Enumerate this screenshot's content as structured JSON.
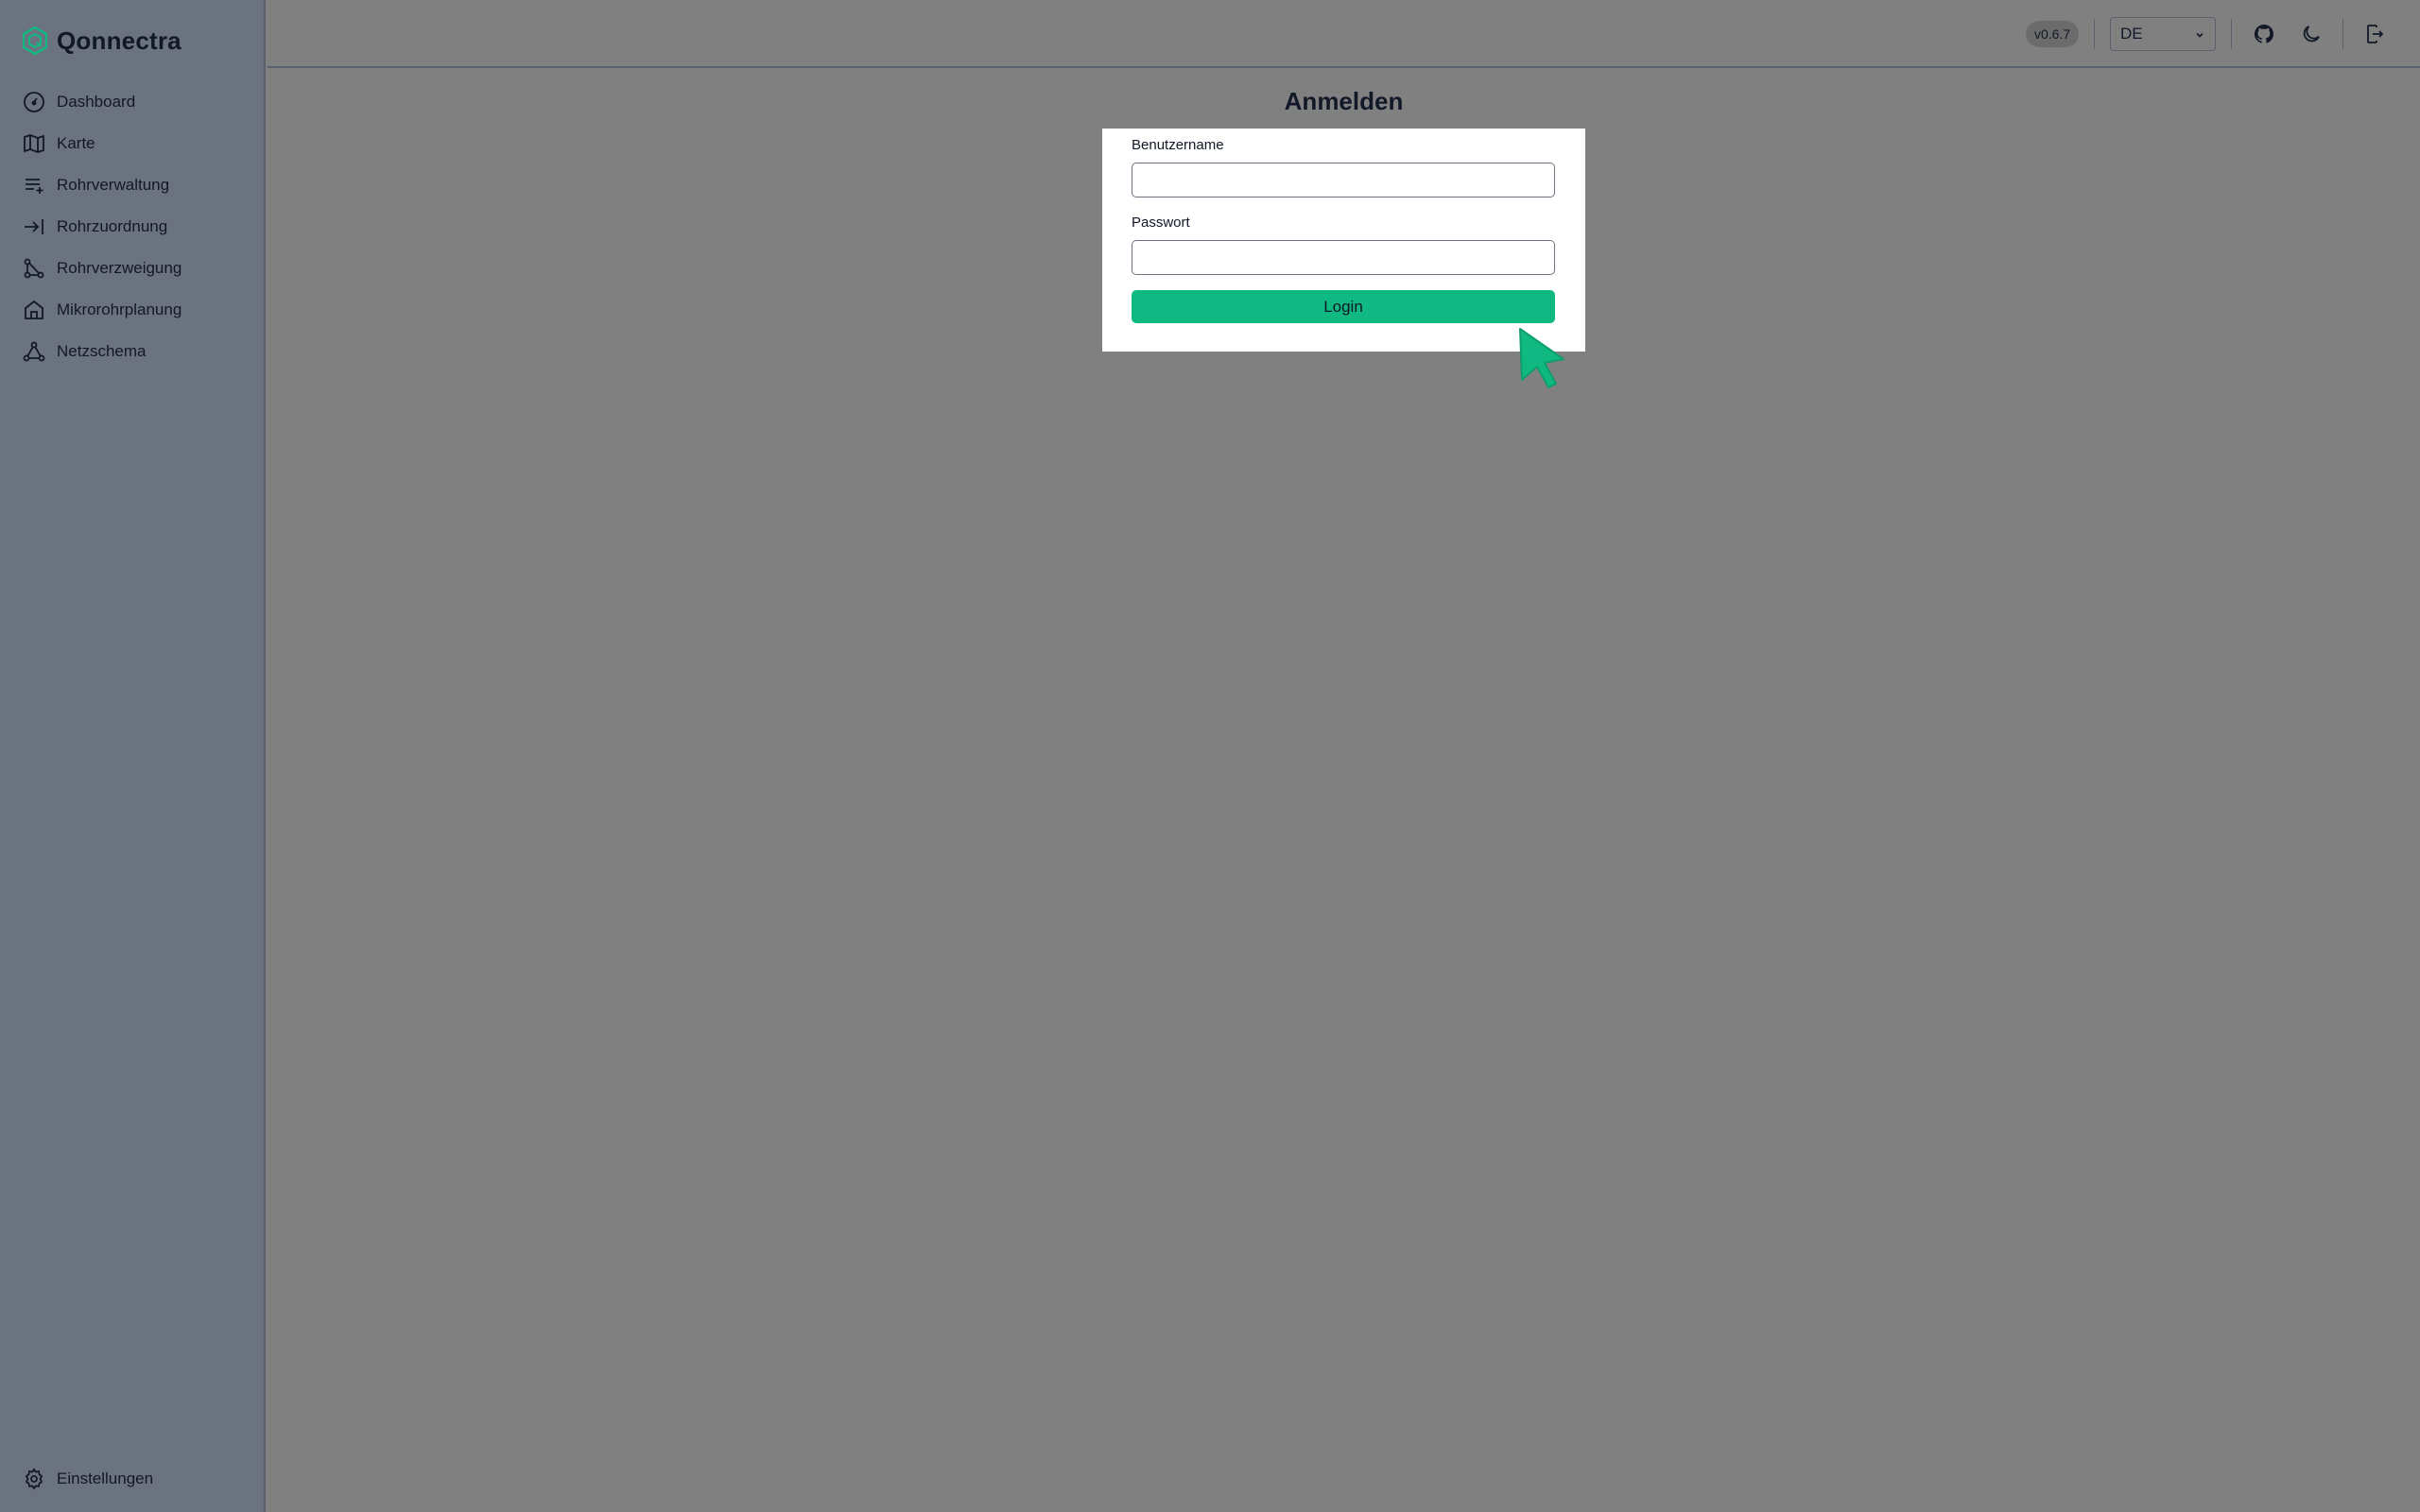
{
  "app": {
    "name": "Qonnectra",
    "brand_color": "#10b981"
  },
  "sidebar": {
    "items": [
      {
        "label": "Dashboard",
        "icon": "dashboard-gauge-icon"
      },
      {
        "label": "Karte",
        "icon": "map-icon"
      },
      {
        "label": "Rohrverwaltung",
        "icon": "list-plus-icon"
      },
      {
        "label": "Rohrzuordnung",
        "icon": "arrow-to-line-icon"
      },
      {
        "label": "Rohrverzweigung",
        "icon": "branch-icon"
      },
      {
        "label": "Mikrorohrplanung",
        "icon": "house-icon"
      },
      {
        "label": "Netzschema",
        "icon": "network-triangle-icon"
      }
    ],
    "settings": {
      "label": "Einstellungen",
      "icon": "gear-icon"
    }
  },
  "header": {
    "version": "v0.6.7",
    "language": {
      "selected": "DE"
    },
    "icons": [
      "github-icon",
      "moon-icon",
      "logout-icon"
    ]
  },
  "login": {
    "title": "Anmelden",
    "username_label": "Benutzername",
    "username_value": "",
    "password_label": "Passwort",
    "password_value": "",
    "button_label": "Login"
  }
}
